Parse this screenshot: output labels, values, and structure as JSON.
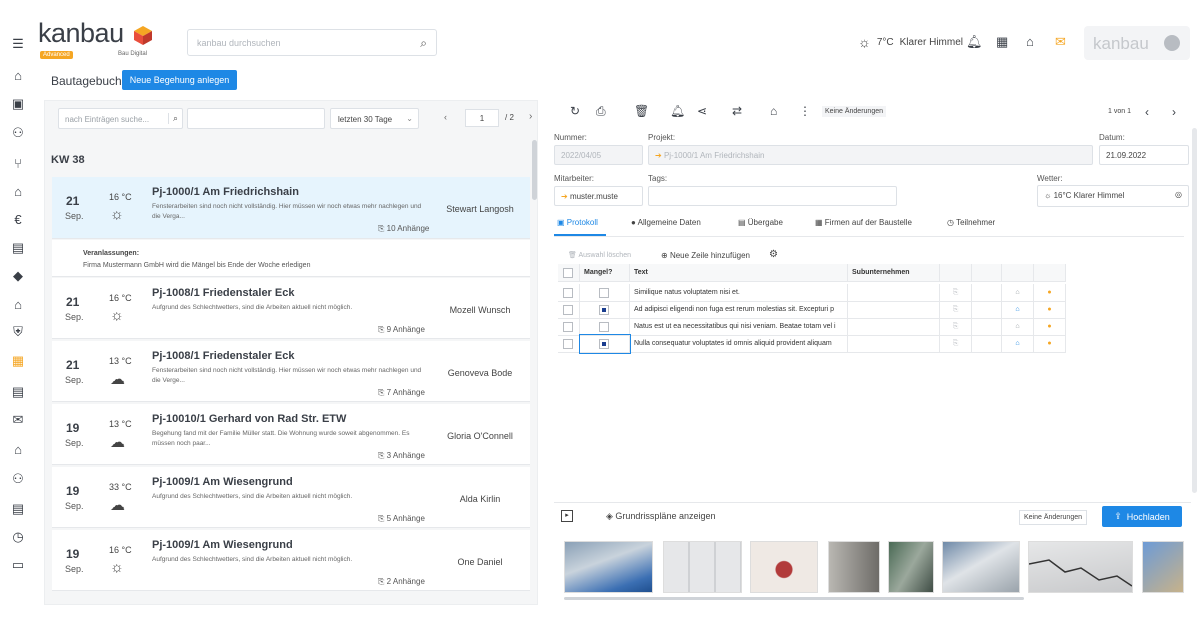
{
  "sidebar": {
    "icons": [
      "menu-icon",
      "home-icon",
      "contacts-icon",
      "people-icon",
      "branch-icon",
      "building-icon",
      "euro-icon",
      "id-card-icon",
      "tag-icon",
      "house-icon",
      "shield-icon",
      "calendar-icon",
      "document-icon",
      "mail-icon",
      "bank-icon",
      "group-icon",
      "list-icon",
      "clock-icon",
      "monitor-icon"
    ]
  },
  "header": {
    "logo": "kanbau",
    "logo_badge": "Advanced",
    "logo_sub": "Bau Digital",
    "search_placeholder": "kanbau durchsuchen",
    "weather_temp": "7°C",
    "weather_text": "Klarer Himmel",
    "user_brand": "kanbau"
  },
  "page": {
    "title": "Bautagebuch",
    "new_button": "Neue Begehung anlegen"
  },
  "filter": {
    "search_placeholder": "nach Einträgen suche...",
    "range": "letzten 30 Tage",
    "page_current": "1",
    "page_of": "/ 2"
  },
  "week": "KW 38",
  "entries": [
    {
      "day": "21",
      "month": "Sep.",
      "temp": "16 °C",
      "weather": "sun",
      "title": "Pj-1000/1 Am Friedrichshain",
      "desc": "Fensterarbeiten sind noch nicht vollständig. Hier müssen wir noch etwas mehr nachlegen und die Verga...",
      "attachments": "10 Anhänge",
      "person": "Stewart Langosh"
    },
    {
      "day": "21",
      "month": "Sep.",
      "temp": "16 °C",
      "weather": "sun",
      "title": "Pj-1008/1 Friedenstaler Eck",
      "desc": "Aufgrund des Schlechtwetters, sind die Arbeiten aktuell nicht möglich.",
      "attachments": "9 Anhänge",
      "person": "Mozell Wunsch"
    },
    {
      "day": "21",
      "month": "Sep.",
      "temp": "13 °C",
      "weather": "cloud",
      "title": "Pj-1008/1 Friedenstaler Eck",
      "desc": "Fensterarbeiten sind noch nicht vollständig. Hier müssen wir noch etwas mehr nachlegen und die Verge...",
      "attachments": "7 Anhänge",
      "person": "Genoveva Bode"
    },
    {
      "day": "19",
      "month": "Sep.",
      "temp": "13 °C",
      "weather": "cloud",
      "title": "Pj-10010/1 Gerhard von Rad Str. ETW",
      "desc": "Begehung fand mit der Familie Müller statt. Die Wohnung wurde soweit abgenommen. Es müssen noch paar...",
      "attachments": "3 Anhänge",
      "person": "Gloria O'Connell"
    },
    {
      "day": "19",
      "month": "Sep.",
      "temp": "33 °C",
      "weather": "cloud",
      "title": "Pj-1009/1 Am Wiesengrund",
      "desc": "Aufgrund des Schlechtwetters, sind die Arbeiten aktuell nicht möglich.",
      "attachments": "5 Anhänge",
      "person": "Alda Kirlin"
    },
    {
      "day": "19",
      "month": "Sep.",
      "temp": "16 °C",
      "weather": "sun",
      "title": "Pj-1009/1 Am Wiesengrund",
      "desc": "Aufgrund des Schlechtwetters, sind die Arbeiten aktuell nicht möglich.",
      "attachments": "2 Anhänge",
      "person": "One Daniel"
    }
  ],
  "veranlassungen": {
    "title": "Veranlassungen:",
    "text": "Firma Mustermann GmbH wird die Mängel bis Ende der Woche erledigen"
  },
  "detail": {
    "toolbar_status": "Keine Änderungen",
    "count": "1 von 1",
    "nummer_label": "Nummer:",
    "nummer": "2022/04/05",
    "projekt_label": "Projekt:",
    "projekt": "Pj-1000/1 Am Friedrichshain",
    "datum_label": "Datum:",
    "datum": "21.09.2022",
    "mitarbeiter_label": "Mitarbeiter:",
    "mitarbeiter": "muster.muste",
    "tags_label": "Tags:",
    "wetter_label": "Wetter:",
    "wetter": "16°C  Klarer Himmel",
    "tabs": [
      "Protokoll",
      "Allgemeine Daten",
      "Übergabe",
      "Firmen auf der Baustelle",
      "Teilnehmer"
    ],
    "delete_label": "Auswahl löschen",
    "add_row_label": "Neue Zeile hinzufügen",
    "columns": {
      "mangel": "Mangel?",
      "text": "Text",
      "sub": "Subunternehmen"
    },
    "rows": [
      {
        "mangel": false,
        "text": "Similique natus voluptatem nisi et.",
        "status_color": "#9aa0a6"
      },
      {
        "mangel": true,
        "text": "Ad adipisci eligendi non fuga est rerum molestias sit. Excepturi p",
        "status_color": "#1e88e5"
      },
      {
        "mangel": false,
        "text": "Natus est ut ea necessitatibus qui nisi veniam. Beatae totam vel i",
        "status_color": "#9aa0a6"
      },
      {
        "mangel": true,
        "text": "Nulla consequatur voluptates id omnis aliquid provident aliquam",
        "status_color": "#1e88e5"
      }
    ],
    "plans_label": "Grundrisspläne anzeigen",
    "plans_status": "Keine Änderungen",
    "upload_label": "Hochladen"
  },
  "colors": {
    "accent": "#1e88e5",
    "pin": "#f5a623"
  }
}
